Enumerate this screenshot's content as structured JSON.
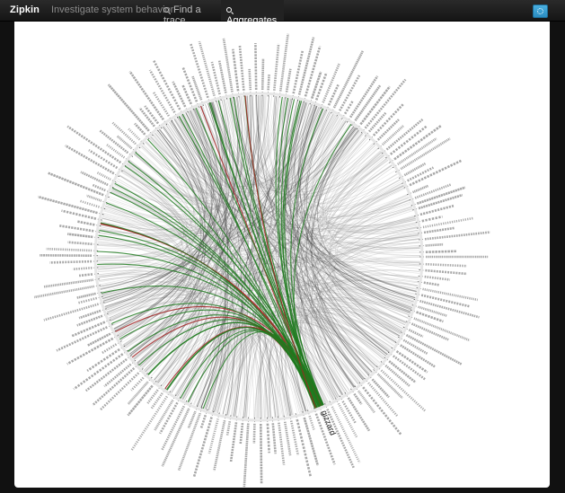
{
  "header": {
    "brand": "Zipkin",
    "tagline": "Investigate system behavior",
    "tabs": [
      {
        "label": "Find a trace",
        "active": false
      },
      {
        "label": "Aggregates",
        "active": true
      }
    ],
    "settings_icon": "gear-icon"
  },
  "colors": {
    "navbar": "#1c1c1c",
    "accent": "#2f95cc",
    "link_normal": "#999999",
    "link_dark": "#333333",
    "link_highlight_in": "#1f7a1f",
    "link_highlight_out": "#a42222"
  },
  "diagram": {
    "type": "chord-dependency-graph",
    "highlighted_service": "gizzard"
  }
}
